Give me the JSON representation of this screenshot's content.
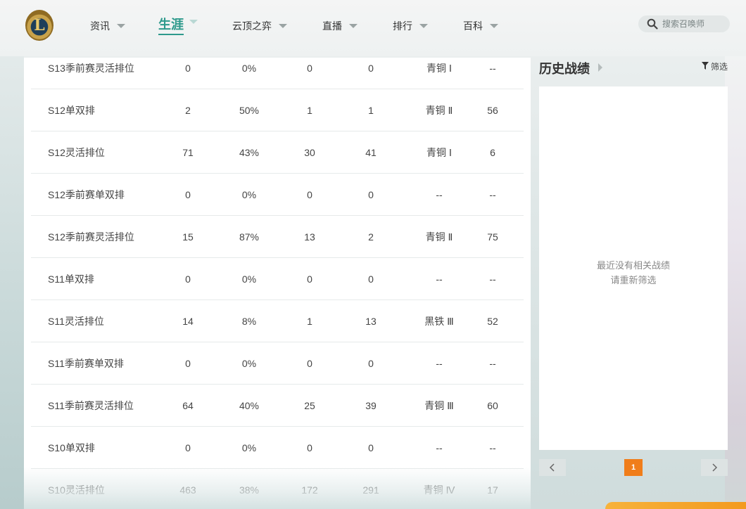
{
  "brand": {
    "logo_letter": "L"
  },
  "nav": {
    "items": [
      {
        "label": "资讯"
      },
      {
        "label": "生涯"
      },
      {
        "label": "云顶之弈"
      },
      {
        "label": "直播"
      },
      {
        "label": "排行"
      },
      {
        "label": "百科"
      }
    ],
    "active": "生涯"
  },
  "search": {
    "placeholder": "搜索召唤师"
  },
  "ranked_table": {
    "rows": [
      [
        "S13季前赛灵活排位",
        "0",
        "0%",
        "0",
        "0",
        "青铜 Ⅰ",
        "--"
      ],
      [
        "S12单双排",
        "2",
        "50%",
        "1",
        "1",
        "青铜 Ⅱ",
        "56"
      ],
      [
        "S12灵活排位",
        "71",
        "43%",
        "30",
        "41",
        "青铜 Ⅰ",
        "6"
      ],
      [
        "S12季前赛单双排",
        "0",
        "0%",
        "0",
        "0",
        "--",
        "--"
      ],
      [
        "S12季前赛灵活排位",
        "15",
        "87%",
        "13",
        "2",
        "青铜 Ⅱ",
        "75"
      ],
      [
        "S11单双排",
        "0",
        "0%",
        "0",
        "0",
        "--",
        "--"
      ],
      [
        "S11灵活排位",
        "14",
        "8%",
        "1",
        "13",
        "黑铁 Ⅲ",
        "52"
      ],
      [
        "S11季前赛单双排",
        "0",
        "0%",
        "0",
        "0",
        "--",
        "--"
      ],
      [
        "S11季前赛灵活排位",
        "64",
        "40%",
        "25",
        "39",
        "青铜 Ⅲ",
        "60"
      ],
      [
        "S10单双排",
        "0",
        "0%",
        "0",
        "0",
        "--",
        "--"
      ],
      [
        "S10灵活排位",
        "463",
        "38%",
        "172",
        "291",
        "青铜 Ⅳ",
        "17"
      ]
    ]
  },
  "history": {
    "title": "历史战绩",
    "filter_label": "筛选",
    "empty_line1": "最近没有相关战绩",
    "empty_line2": "请重新筛选",
    "current_page": "1"
  },
  "icons": {
    "search": "search-icon",
    "filter": "filter-icon",
    "prev": "chevron-left-icon",
    "next": "chevron-right-icon"
  },
  "colors": {
    "accent": "#2e9a8c",
    "page_active": "#f07d1a"
  }
}
